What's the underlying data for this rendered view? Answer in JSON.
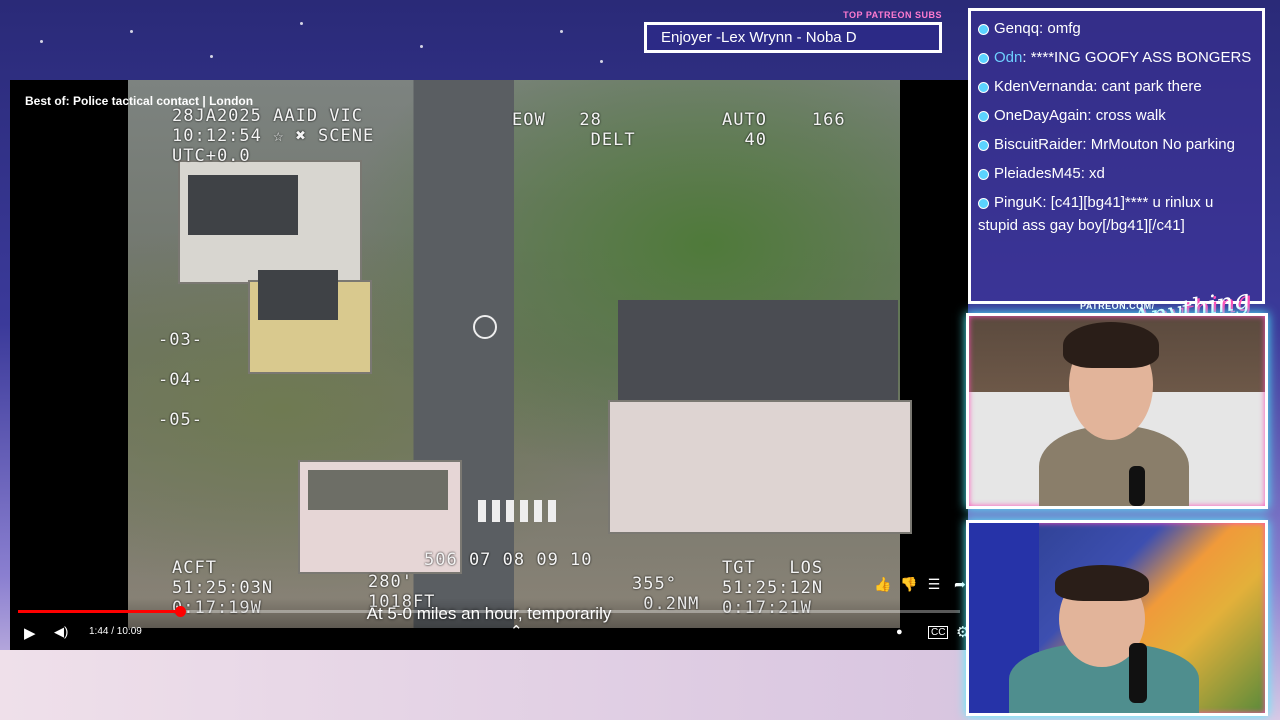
{
  "patreon_top": {
    "label": "TOP PATREON SUBS",
    "names": "Enjoyer -Lex Wrynn -  Noba D"
  },
  "player": {
    "title": "Best of: Police tactical contact | London",
    "subtitle": "At 5-0 miles an hour, temporarily",
    "time": "1:44 / 10:09",
    "progress_fraction": 0.172,
    "osd": {
      "top_left": "28JA2025 AAID VIC\n10:12:54 ☆ ✖ SCENE\nUTC+0.0",
      "top_mid": "EOW   28\n       DELT",
      "top_right": "AUTO    166\n  40",
      "scale_03": "-03-",
      "scale_04": "-04-",
      "scale_05": "-05-",
      "bottom_left": "ACFT\n51:25:03N\n0:17:19W",
      "bottom_mid_left": "280'\n1018FT",
      "bottom_ticks": "506 07 08 09 10",
      "bottom_mid": "355°\n 0.2NM",
      "bottom_right": "TGT   LOS\n51:25:12N\n0:17:21W"
    }
  },
  "chat": {
    "messages": [
      {
        "name": "Genqq",
        "text": ": omfg",
        "cyan": false
      },
      {
        "name": "Odn",
        "text": ": ****ING GOOFY ASS BONGERS",
        "cyan": true
      },
      {
        "name": "KdenVernanda",
        "text": ": cant park there",
        "cyan": false
      },
      {
        "name": "OneDayAgain",
        "text": ": cross walk",
        "cyan": false
      },
      {
        "name": "BiscuitRaider",
        "text": ": MrMouton No parking",
        "cyan": false
      },
      {
        "name": "PleiadesM45",
        "text": ": xd",
        "cyan": false
      },
      {
        "name": "PinguK",
        "text": ": [c41][bg41]**** u rinlux u stupid ass gay boy[/bg41][/c41]",
        "cyan": false
      }
    ]
  },
  "patreon_logo": {
    "small": "PATREON.COM/",
    "script": "Anything Else"
  },
  "icons": {
    "play": "▶",
    "volume": "◀)",
    "like": "👍",
    "dislike": "👎",
    "comment": "☰",
    "share": "➦",
    "captions": "CC",
    "settings": "⚙",
    "autoplay": "●",
    "chevron_up": "⌃"
  }
}
